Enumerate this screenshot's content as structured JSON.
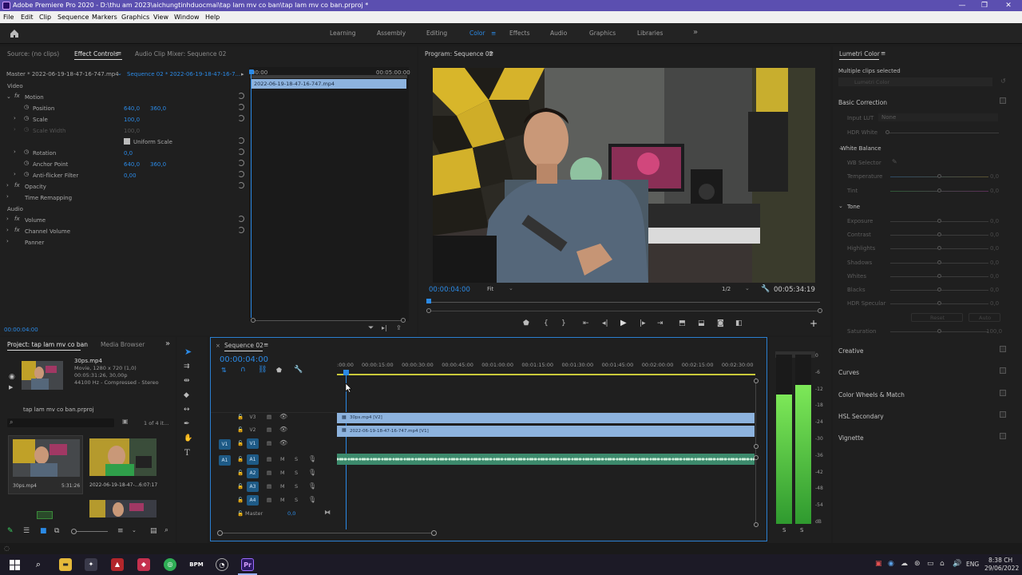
{
  "title_bar": {
    "title": "Adobe Premiere Pro 2020 - D:\\thu am 2023\\aichungtinhduocmai\\tap lam mv co ban\\tap lam mv co ban.prproj *",
    "minimize": "—",
    "maximize": "❐",
    "close": "✕"
  },
  "menu": [
    "File",
    "Edit",
    "Clip",
    "Sequence",
    "Markers",
    "Graphics",
    "View",
    "Window",
    "Help"
  ],
  "workspaces": {
    "items": [
      "Learning",
      "Assembly",
      "Editing",
      "Color",
      "Effects",
      "Audio",
      "Graphics",
      "Libraries"
    ],
    "active": "Color",
    "more": "»"
  },
  "effect_controls": {
    "tabs": [
      "Source: (no clips)",
      "Effect Controls",
      "Audio Clip Mixer: Sequence 02"
    ],
    "master_label": "Master * 2022-06-19-18-47-16-747.mp4",
    "sequence_label": "Sequence 02 * 2022-06-19-18-47-16-7...",
    "ruler_start": "00:00",
    "ruler_end": "00:05:00:00",
    "clip_name": "2022-06-19-18-47-16-747.mp4",
    "video_header": "Video",
    "audio_header": "Audio",
    "rows": [
      {
        "label": "Motion"
      },
      {
        "label": "Position",
        "v1": "640,0",
        "v2": "360,0"
      },
      {
        "label": "Scale",
        "v1": "100,0"
      },
      {
        "label": "Scale Width",
        "v1": "100,0"
      },
      {
        "label": "Uniform Scale"
      },
      {
        "label": "Rotation",
        "v1": "0,0"
      },
      {
        "label": "Anchor Point",
        "v1": "640,0",
        "v2": "360,0"
      },
      {
        "label": "Anti-flicker Filter",
        "v1": "0,00"
      },
      {
        "label": "Opacity"
      },
      {
        "label": "Time Remapping"
      },
      {
        "label": "Volume"
      },
      {
        "label": "Channel Volume"
      },
      {
        "label": "Panner"
      }
    ],
    "timecode": "00:00:04:00"
  },
  "program_monitor": {
    "title": "Program: Sequence 02",
    "timecode": "00:00:04:00",
    "fit": "Fit",
    "resolution": "1/2",
    "duration": "00:05:34:19"
  },
  "lumetri": {
    "title": "Lumetri Color",
    "multiple": "Multiple clips selected",
    "dropdown": "Lumetri Color",
    "basic_correction": "Basic Correction",
    "input_lut": "Input LUT",
    "input_lut_value": "None",
    "hdr_white": "HDR White",
    "white_balance": "White Balance",
    "wb_selector": "WB Selector",
    "wb_rows": [
      {
        "label": "Temperature",
        "value": "0,0"
      },
      {
        "label": "Tint",
        "value": "0,0"
      }
    ],
    "tone": "Tone",
    "tone_rows": [
      {
        "label": "Exposure",
        "value": "0,0"
      },
      {
        "label": "Contrast",
        "value": "0,0"
      },
      {
        "label": "Highlights",
        "value": "0,0"
      },
      {
        "label": "Shadows",
        "value": "0,0"
      },
      {
        "label": "Whites",
        "value": "0,0"
      },
      {
        "label": "Blacks",
        "value": "0,0"
      },
      {
        "label": "HDR Specular",
        "value": "0,0"
      }
    ],
    "reset": "Reset",
    "auto": "Auto",
    "saturation": "Saturation",
    "saturation_value": "100,0",
    "sections": [
      "Creative",
      "Curves",
      "Color Wheels & Match",
      "HSL Secondary",
      "Vignette"
    ]
  },
  "project": {
    "tabs": [
      "Project: tap lam mv co ban",
      "Media Browser"
    ],
    "preview_name": "30ps.mp4",
    "preview_info1": "Movie, 1280 x 720 (1,0)",
    "preview_info2": "00:05:31:26, 30,00p",
    "preview_info3": "44100 Hz - Compressed - Stereo",
    "project_file": "tap lam mv co ban.prproj",
    "items_count": "1 of 4 it...",
    "items": [
      {
        "name": "30ps.mp4",
        "duration": "5:31:26"
      },
      {
        "name": "2022-06-19-18-47-...",
        "duration": "6:07:17"
      }
    ]
  },
  "timeline": {
    "title": "Sequence 02",
    "timecode": "00:00:04:00",
    "ruler": [
      ":00:00",
      "00:00:15:00",
      "00:00:30:00",
      "00:00:45:00",
      "00:01:00:00",
      "00:01:15:00",
      "00:01:30:00",
      "00:01:45:00",
      "00:02:00:00",
      "00:02:15:00",
      "00:02:30:00"
    ],
    "video_tracks": [
      "V3",
      "V2",
      "V1"
    ],
    "audio_tracks": [
      "A1",
      "A2",
      "A3",
      "A4"
    ],
    "source_v": "V1",
    "source_a": "A1",
    "master_label": "Master",
    "master_value": "0,0",
    "clip_v3": "30ps.mp4 [V2]",
    "clip_v2": "2022-06-19-18-47-16-747.mp4 [V1]"
  },
  "audio_meter": {
    "scale": [
      "0",
      "-6",
      "-12",
      "-18",
      "-24",
      "-30",
      "-36",
      "-42",
      "-48",
      "-54",
      "dB"
    ],
    "solo": [
      "S",
      "S"
    ]
  },
  "taskbar": {
    "language": "ENG",
    "time": "8:38 CH",
    "date": "29/06/2022",
    "bpm": "BPM",
    "pr": "Pr"
  },
  "colors": {
    "accent": "#2b8ae6",
    "clip_video": "#8db3de",
    "clip_audio": "#3c8a6c",
    "title_bar": "#5b4fb0"
  }
}
